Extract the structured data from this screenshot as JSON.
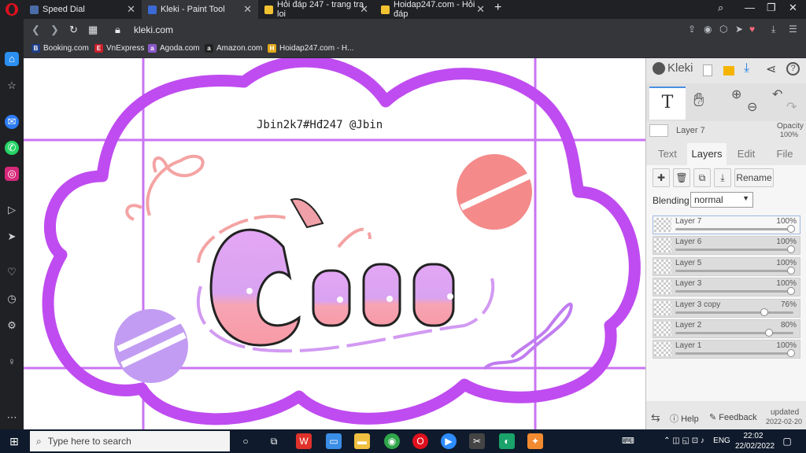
{
  "browser": {
    "tabs": [
      {
        "label": "Speed Dial",
        "color": "#4a6da7"
      },
      {
        "label": "Kleki - Paint Tool",
        "color": "#3b6ad6"
      },
      {
        "label": "Hỏi đáp 247 - trang tra loi",
        "color": "#f2c230"
      },
      {
        "label": "Hoidap247.com - Hỏi đáp",
        "color": "#f2c230"
      }
    ],
    "url": "kleki.com",
    "bookmarks": [
      {
        "label": "Booking.com",
        "letter": "B",
        "color": "#1e3f8a"
      },
      {
        "label": "VnExpress",
        "letter": "E",
        "color": "#c8202b"
      },
      {
        "label": "Agoda.com",
        "letter": "a",
        "color": "#8a58c8"
      },
      {
        "label": "Amazon.com",
        "letter": "a",
        "color": "#222222"
      },
      {
        "label": "Hoidap247.com - H...",
        "letter": "H",
        "color": "#e0a818"
      }
    ]
  },
  "canvas": {
    "signature": "Jbin2k7#Hđ247 @Jbin",
    "art_text": "Cute",
    "accent": "#bf4cf0"
  },
  "kleki": {
    "logo": "Kleki",
    "current_layer": "Layer 7",
    "opacity_label": "Opacity",
    "opacity_value": "100%",
    "tabs": [
      "Text",
      "Layers",
      "Edit",
      "File"
    ],
    "active_tab": "Layers",
    "rename_label": "Rename",
    "blending_label": "Blending",
    "blending_value": "normal",
    "layers": [
      {
        "name": "Layer 7",
        "opacity": "100%",
        "value": 1.0
      },
      {
        "name": "Layer 6",
        "opacity": "100%",
        "value": 1.0
      },
      {
        "name": "Layer 5",
        "opacity": "100%",
        "value": 1.0
      },
      {
        "name": "Layer 3",
        "opacity": "100%",
        "value": 1.0
      },
      {
        "name": "Layer 3 copy",
        "opacity": "76%",
        "value": 0.76
      },
      {
        "name": "Layer 2",
        "opacity": "80%",
        "value": 0.8
      },
      {
        "name": "Layer 1",
        "opacity": "100%",
        "value": 1.0
      }
    ],
    "help_label": "Help",
    "feedback_label": "Feedback",
    "updated_label": "updated",
    "updated_date": "2022-02-20"
  },
  "taskbar": {
    "search_placeholder": "Type here to search",
    "language": "ENG",
    "time": "22:02",
    "date": "22/02/2022"
  }
}
